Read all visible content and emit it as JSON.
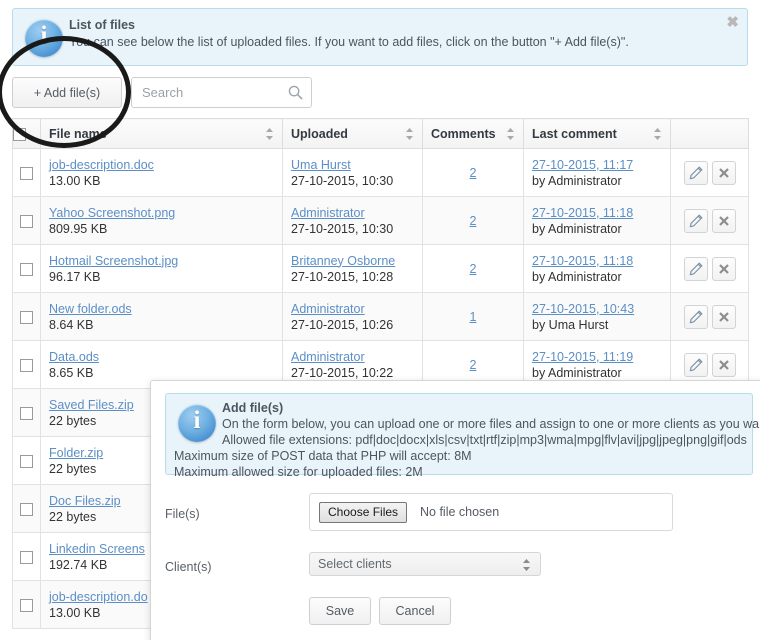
{
  "page": {
    "title": "List of files"
  },
  "list_banner": {
    "icon": "info-icon",
    "title": "List of files",
    "line1": "You can see below the list of uploaded files. If you want to add files, click on the button \"+ Add file(s)\".",
    "close_label": "✖"
  },
  "toolbar": {
    "add_files_label": "+ Add file(s)",
    "search_placeholder": "Search",
    "search_value": "",
    "search_icon": "search-icon"
  },
  "table": {
    "columns": [
      {
        "key": "checkbox",
        "label": ""
      },
      {
        "key": "name",
        "label": "File name",
        "sortable": true
      },
      {
        "key": "uploaded",
        "label": "Uploaded",
        "sortable": true
      },
      {
        "key": "comments",
        "label": "Comments",
        "sortable": true
      },
      {
        "key": "last_comment",
        "label": "Last comment",
        "sortable": true
      },
      {
        "key": "actions",
        "label": ""
      }
    ],
    "rows": [
      {
        "name": "job-description.doc",
        "size": "13.00 KB",
        "uploader": "Uma Hurst",
        "uploaded_at": "27-10-2015, 10:30",
        "comments": "2",
        "last_comment_time": "27-10-2015, 11:17",
        "last_comment_by": "by Administrator"
      },
      {
        "name": "Yahoo Screenshot.png",
        "size": "809.95 KB",
        "uploader": "Administrator",
        "uploaded_at": "27-10-2015, 10:30",
        "comments": "2",
        "last_comment_time": "27-10-2015, 11:18",
        "last_comment_by": "by Administrator"
      },
      {
        "name": "Hotmail Screenshot.jpg",
        "size": "96.17 KB",
        "uploader": "Britanney Osborne",
        "uploaded_at": "27-10-2015, 10:28",
        "comments": "2",
        "last_comment_time": "27-10-2015, 11:18",
        "last_comment_by": "by Administrator"
      },
      {
        "name": "New folder.ods",
        "size": "8.64 KB",
        "uploader": "Administrator",
        "uploaded_at": "27-10-2015, 10:26",
        "comments": "1",
        "last_comment_time": "27-10-2015, 10:43",
        "last_comment_by": "by Uma Hurst"
      },
      {
        "name": "Data.ods",
        "size": "8.65 KB",
        "uploader": "Administrator",
        "uploaded_at": "27-10-2015, 10:22",
        "comments": "2",
        "last_comment_time": "27-10-2015, 11:19",
        "last_comment_by": "by Administrator"
      },
      {
        "name": "Saved Files.zip",
        "size": "22 bytes",
        "uploader": "",
        "uploaded_at": "",
        "comments": "",
        "last_comment_time": "",
        "last_comment_by": ""
      },
      {
        "name": "Folder.zip",
        "size": "22 bytes",
        "uploader": "",
        "uploaded_at": "",
        "comments": "",
        "last_comment_time": "",
        "last_comment_by": ""
      },
      {
        "name": "Doc Files.zip",
        "size": "22 bytes",
        "uploader": "",
        "uploaded_at": "",
        "comments": "",
        "last_comment_time": "",
        "last_comment_by": ""
      },
      {
        "name": "Linkedin Screens",
        "size": "192.74 KB",
        "uploader": "",
        "uploaded_at": "",
        "comments": "",
        "last_comment_time": "",
        "last_comment_by": ""
      },
      {
        "name": "job-description.do",
        "size": "13.00 KB",
        "uploader": "",
        "uploaded_at": "",
        "comments": "",
        "last_comment_time": "",
        "last_comment_by": ""
      }
    ],
    "row_actions": {
      "edit": "pencil-icon",
      "delete": "x-icon"
    }
  },
  "modal": {
    "banner": {
      "icon": "info-icon",
      "title": "Add file(s)",
      "line1": "On the form below, you can upload one or more files and assign to one or more clients as you want.",
      "line2": "Allowed file extensions: pdf|doc|docx|xls|csv|txt|rtf|zip|mp3|wma|mpg|flv|avi|jpg|jpeg|png|gif|ods",
      "line3": "Maximum size of POST data that PHP will accept: 8M",
      "line4": "Maximum allowed size for uploaded files: 2M"
    },
    "files_label": "File(s)",
    "choose_files_label": "Choose Files",
    "no_file_text": "No file chosen",
    "clients_label": "Client(s)",
    "clients_selected": "Select clients",
    "save_label": "Save",
    "cancel_label": "Cancel"
  },
  "colors": {
    "banner_bg": "#e8f4fa",
    "banner_border": "#b8dcee",
    "link": "#5b8fc7",
    "annotation": "#1a1a1a"
  }
}
